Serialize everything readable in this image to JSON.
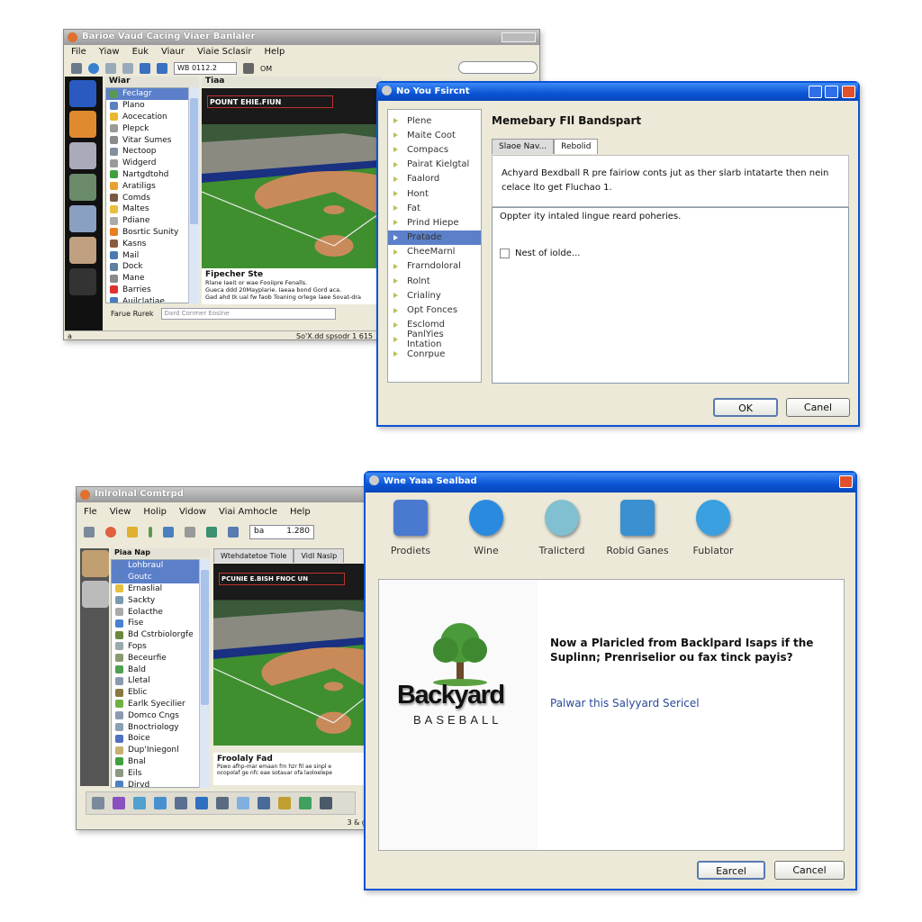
{
  "window1": {
    "title": "Barioe Vaud Cacing Viaer Banlaler",
    "menu": [
      "File",
      "Yiaw",
      "Euk",
      "Viaur",
      "Viaie Sclasir",
      "Help"
    ],
    "toolbar_combo": "WB 0112.2",
    "toolbar_label": "OM",
    "list_header": "Wiar",
    "list_items": [
      {
        "label": "Feclagr",
        "color": "#5a9a50",
        "selected": true
      },
      {
        "label": "Plano",
        "color": "#5a80c0"
      },
      {
        "label": "Aocecation",
        "color": "#e8b830"
      },
      {
        "label": "Plepck",
        "color": "#9a9a9a"
      },
      {
        "label": "Vitar Sumes",
        "color": "#8a8a8a"
      },
      {
        "label": "Nectoop",
        "color": "#8090a0"
      },
      {
        "label": "Widgerd",
        "color": "#9a9a9a"
      },
      {
        "label": "Nartgdtohd",
        "color": "#40a040"
      },
      {
        "label": "Aratiligs",
        "color": "#e8a030"
      },
      {
        "label": "Comds",
        "color": "#7a5a40"
      },
      {
        "label": "Maltes",
        "color": "#e8c040"
      },
      {
        "label": "Pdiane",
        "color": "#aaaaaa"
      },
      {
        "label": "Bosrtic Sunity",
        "color": "#e88020"
      },
      {
        "label": "Kasns",
        "color": "#8a5a40"
      },
      {
        "label": "Mail",
        "color": "#4a7ab0"
      },
      {
        "label": "Dock",
        "color": "#6080a0"
      },
      {
        "label": "Mane",
        "color": "#8a8a8a"
      },
      {
        "label": "Barries",
        "color": "#e03030"
      },
      {
        "label": "Auilclatiae",
        "color": "#4a7ac0"
      }
    ],
    "game_header": "Tiaa",
    "game_banner": "POUNT EHIE.FIUN",
    "caption_title": "Fipecher Ste",
    "caption_lines": [
      "Rlane Iaeit or wae Fooiipre Fenalls.",
      "Gueca ddd 20Mayplarie. Iaeaa bond Gord aca.",
      "Gad ahd tk ual fw faob Toaning orlege laee Sovat-dra"
    ],
    "search_label": "Farue Rurek",
    "search_value": "Dard Conmer Eoslne",
    "status_left": "a",
    "status_right": "So'X.dd spsodr 1 615"
  },
  "dialog1": {
    "title": "No You Fsircnt",
    "nav_items": [
      "Plene",
      "Maite Coot",
      "Compacs",
      "Pairat Kielgtal",
      "Faalord",
      "Hont",
      "Fat",
      "Prind Hiepe",
      "Pratade",
      "CheeMarnl",
      "Frarndoloral",
      "Rolnt",
      "Crialiny",
      "Opt Fonces",
      "Esclomd",
      "PanlYies Intation",
      "Conrpue"
    ],
    "selected_index": 8,
    "heading": "Memebary FIl Bandspart",
    "tabs": [
      "Slaoe Nav...",
      "Rebolid"
    ],
    "active_tab": 1,
    "description": "Achyard Bexdball R pre fairiow conts jut as ther slarb intatarte then nein celace lto get Fluchao 1.",
    "panel_text": "Oppter ity intaled lingue reard poheries.",
    "checkbox_label": "Nest of iolde...",
    "checkbox_checked": false,
    "ok": "OK",
    "cancel": "Canel"
  },
  "window2": {
    "title": "Inlrolnal Comtrpd",
    "menu": [
      "Fle",
      "View",
      "Holip",
      "Vidow",
      "Viai Amhocle",
      "Help"
    ],
    "toolbar_combo_label": "ba",
    "toolbar_combo_value": "1.280",
    "list_header": "Piaa Nap",
    "list_items": [
      {
        "label": "Lohbraul",
        "color": "#5a80c0",
        "selected": true
      },
      {
        "label": "Goutc",
        "color": "#5a80c0",
        "selected": true
      },
      {
        "label": "Ernaslial",
        "color": "#e8c040"
      },
      {
        "label": "Sackty",
        "color": "#7a9ab0"
      },
      {
        "label": "Eolacthe",
        "color": "#aaa"
      },
      {
        "label": "Fise",
        "color": "#4a80d0"
      },
      {
        "label": "Bd Cstrbiolorgfe",
        "color": "#6a8a40"
      },
      {
        "label": "Fops",
        "color": "#9aa"
      },
      {
        "label": "Beceurfie",
        "color": "#8a9a70"
      },
      {
        "label": "Bald",
        "color": "#50a050"
      },
      {
        "label": "Lletal",
        "color": "#8a9ab0"
      },
      {
        "label": "Eblic",
        "color": "#8a7a40"
      },
      {
        "label": "Earlk Syecilier",
        "color": "#70b040"
      },
      {
        "label": "Domco Cngs",
        "color": "#8a9ab0"
      },
      {
        "label": "Bnoctriology",
        "color": "#8aa0b0"
      },
      {
        "label": "Boice",
        "color": "#5070c0"
      },
      {
        "label": "Dup'Iniegonl",
        "color": "#c8b070"
      },
      {
        "label": "Bnal",
        "color": "#40a040"
      },
      {
        "label": "Eils",
        "color": "#8a9a80"
      },
      {
        "label": "Dirvd",
        "color": "#5080c0"
      }
    ],
    "tabs": [
      "Wtehdatetoe Tiole",
      "Vidl Naslp"
    ],
    "game_banner": "PCUNIE E.BISH FNOC UN",
    "caption_title": "Froolaly Fad",
    "caption_lines": [
      "Pswo afhp-mar emaan frn hzr fIl ae sinpl e",
      "ocopolaf ge nfc eae sotauar ofa laoloelepe"
    ],
    "bottom_icons": [
      "#7a8a9a",
      "#8a50c0",
      "#50a0d0",
      "#4a90d0",
      "#5a7090",
      "#3070c0",
      "#5a6a80",
      "#80b0e0",
      "#4a6a9a",
      "#c0a030",
      "#40a060",
      "#4a5a6a"
    ],
    "status": "3 & g"
  },
  "dialog2": {
    "title": "Wne Yaaa Sealbad",
    "apps": [
      {
        "label": "Prodiets",
        "icon": "f-app-icon",
        "color": "#4a7ad0"
      },
      {
        "label": "Wine",
        "icon": "z-globe-icon",
        "color": "#2a8ae0"
      },
      {
        "label": "Tralicterd",
        "icon": "shield-icon",
        "color": "#80c0d0"
      },
      {
        "label": "Robid Ganes",
        "icon": "globe-box-icon",
        "color": "#3a90d0"
      },
      {
        "label": "Fublator",
        "icon": "p-circle-icon",
        "color": "#3aa0e0"
      }
    ],
    "logo_word": "Backyard",
    "logo_sub": "BASEBALL",
    "question": "Now a Plaricled from Backlpard Isaps if the Suplinn; Prenriselior ou fax tinck payis?",
    "link": "Palwar this Salyyard Sericel",
    "primary": "Earcel",
    "cancel": "Cancel"
  },
  "colors": {
    "xp_blue": "#0a54d4",
    "selection": "#5b7fc9",
    "link": "#2a4a9a",
    "field_green": "#3f8f2f",
    "dirt": "#c98a5a"
  }
}
